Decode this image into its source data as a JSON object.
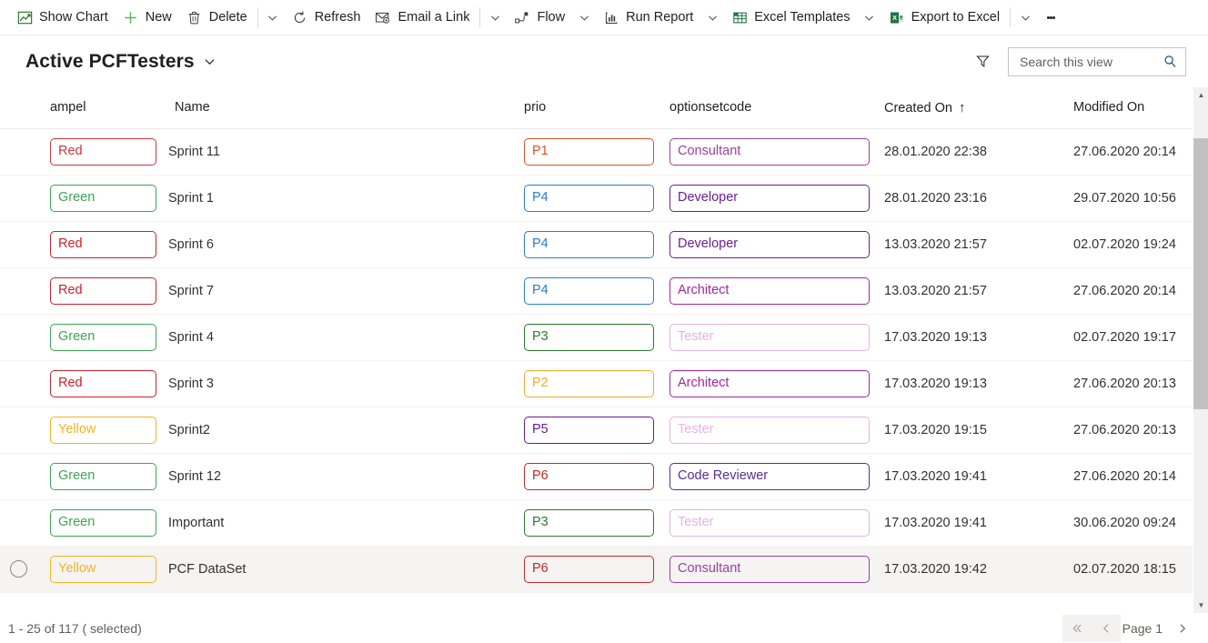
{
  "commandbar": {
    "items": [
      {
        "label": "Show Chart",
        "icon": "show-chart-icon",
        "caret": false
      },
      {
        "label": "New",
        "icon": "plus-icon",
        "caret": false
      },
      {
        "label": "Delete",
        "icon": "trash-icon",
        "caret": true,
        "separator_before_caret": true
      },
      {
        "label": "Refresh",
        "icon": "refresh-icon",
        "caret": false
      },
      {
        "label": "Email a Link",
        "icon": "email-link-icon",
        "caret": true,
        "separator_before_caret": true
      },
      {
        "label": "Flow",
        "icon": "flow-icon",
        "caret": true
      },
      {
        "label": "Run Report",
        "icon": "run-report-icon",
        "caret": true
      },
      {
        "label": "Excel Templates",
        "icon": "excel-templates-icon",
        "caret": true
      },
      {
        "label": "Export to Excel",
        "icon": "export-excel-icon",
        "caret": true,
        "separator_before_caret": true
      }
    ],
    "overflow_label": "more-commands-ellipsis"
  },
  "view": {
    "title": "Active PCFTesters",
    "title_chevron": "chevron-down-icon",
    "filter_icon": "filter-icon",
    "search": {
      "placeholder": "Search this view",
      "value": "",
      "icon": "search-icon"
    }
  },
  "grid": {
    "columns": [
      {
        "key": "ampel",
        "label": "ampel"
      },
      {
        "key": "name",
        "label": "Name"
      },
      {
        "key": "prio",
        "label": "prio"
      },
      {
        "key": "optionsetcode",
        "label": "optionsetcode"
      },
      {
        "key": "created",
        "label": "Created On",
        "sorted": "asc",
        "sort_icon": "arrow-up-icon"
      },
      {
        "key": "modified",
        "label": "Modified On"
      }
    ],
    "rows": [
      {
        "ampel": "Red",
        "ampel_color": "#d13438",
        "name": "Sprint 11",
        "prio": "P1",
        "prio_color": "#e14f25",
        "optionsetcode": "Consultant",
        "opt_color": "#9b3fa0",
        "created": "28.01.2020 22:38",
        "modified": "27.06.2020 20:14",
        "selected": false,
        "hovered": false
      },
      {
        "ampel": "Green",
        "ampel_color": "#3aa652",
        "name": "Sprint 1",
        "prio": "P4",
        "prio_color": "#2b7cd3",
        "optionsetcode": "Developer",
        "opt_color": "#6b1f8f",
        "created": "28.01.2020 23:16",
        "modified": "29.07.2020 10:56",
        "selected": false,
        "hovered": false
      },
      {
        "ampel": "Red",
        "ampel_color": "#cc2128",
        "name": "Sprint 6",
        "prio": "P4",
        "prio_color": "#2b7cd3",
        "optionsetcode": "Developer",
        "opt_color": "#6b1f8f",
        "created": "13.03.2020 21:57",
        "modified": "02.07.2020 19:24",
        "selected": false,
        "hovered": false
      },
      {
        "ampel": "Red",
        "ampel_color": "#cc2128",
        "name": "Sprint 7",
        "prio": "P4",
        "prio_color": "#2b7cd3",
        "optionsetcode": "Architect",
        "opt_color": "#a3269f",
        "created": "13.03.2020 21:57",
        "modified": "27.06.2020 20:14",
        "selected": false,
        "hovered": false
      },
      {
        "ampel": "Green",
        "ampel_color": "#3aa652",
        "name": "Sprint 4",
        "prio": "P3",
        "prio_color": "#2c7a2c",
        "optionsetcode": "Tester",
        "opt_color": "#e3b4e3",
        "created": "17.03.2020 19:13",
        "modified": "02.07.2020 19:17",
        "selected": false,
        "hovered": false
      },
      {
        "ampel": "Red",
        "ampel_color": "#cc2128",
        "name": "Sprint 3",
        "prio": "P2",
        "prio_color": "#f0ab30",
        "optionsetcode": "Architect",
        "opt_color": "#a3269f",
        "created": "17.03.2020 19:13",
        "modified": "27.06.2020 20:13",
        "selected": false,
        "hovered": false
      },
      {
        "ampel": "Yellow",
        "ampel_color": "#f2b41e",
        "name": "Sprint2",
        "prio": "P5",
        "prio_color": "#6a1b9a",
        "optionsetcode": "Tester",
        "opt_color": "#e3b4e3",
        "created": "17.03.2020 19:15",
        "modified": "27.06.2020 20:13",
        "selected": false,
        "hovered": false
      },
      {
        "ampel": "Green",
        "ampel_color": "#3aa652",
        "name": "Sprint 12",
        "prio": "P6",
        "prio_color": "#c62828",
        "optionsetcode": "Code Reviewer",
        "opt_color": "#5b2d91",
        "created": "17.03.2020 19:41",
        "modified": "27.06.2020 20:14",
        "selected": false,
        "hovered": false
      },
      {
        "ampel": "Green",
        "ampel_color": "#3aa652",
        "name": "Important",
        "prio": "P3",
        "prio_color": "#2c7a2c",
        "optionsetcode": "Tester",
        "opt_color": "#e3b4e3",
        "created": "17.03.2020 19:41",
        "modified": "30.06.2020 09:24",
        "selected": false,
        "hovered": false
      },
      {
        "ampel": "Yellow",
        "ampel_color": "#f2b41e",
        "name": "PCF DataSet",
        "prio": "P6",
        "prio_color": "#c62828",
        "optionsetcode": "Consultant",
        "opt_color": "#9b3fa0",
        "created": "17.03.2020 19:42",
        "modified": "02.07.2020 18:15",
        "selected": true,
        "hovered": true
      }
    ]
  },
  "footer": {
    "record_count": "1 - 25 of 117 ( selected)",
    "pager": {
      "first_icon": "double-chevron-left-icon",
      "prev_icon": "chevron-left-icon",
      "page_label": "Page 1",
      "next_icon": "chevron-right-icon"
    }
  }
}
